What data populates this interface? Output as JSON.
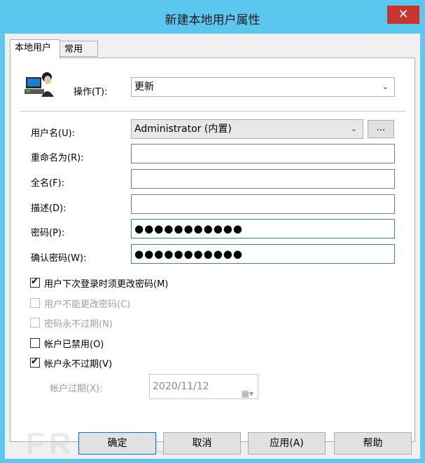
{
  "window": {
    "title": "新建本地用户属性",
    "close_label": "✕"
  },
  "tabs": [
    {
      "label": "本地用户",
      "active": true
    },
    {
      "label": "常用",
      "active": false
    }
  ],
  "icon": {
    "name": "user-computer-icon"
  },
  "operation": {
    "label": "操作(T):",
    "value": "更新"
  },
  "fields": {
    "username": {
      "label": "用户名(U):",
      "value": "Administrator (内置)",
      "browse_label": "..."
    },
    "rename": {
      "label": "重命名为(R):",
      "value": ""
    },
    "fullname": {
      "label": "全名(F):",
      "value": ""
    },
    "description": {
      "label": "描述(D):",
      "value": ""
    },
    "password": {
      "label": "密码(P):",
      "value": "●●●●●●●●●●●"
    },
    "confirm": {
      "label": "确认密码(W):",
      "value": "●●●●●●●●●●●"
    }
  },
  "checkboxes": [
    {
      "label": "用户下次登录时须更改密码(M)",
      "checked": true,
      "disabled": false
    },
    {
      "label": "用户不能更改密码(C)",
      "checked": false,
      "disabled": true
    },
    {
      "label": "密码永不过期(N)",
      "checked": false,
      "disabled": true
    },
    {
      "label": "帐户已禁用(O)",
      "checked": false,
      "disabled": false
    },
    {
      "label": "帐户永不过期(V)",
      "checked": true,
      "disabled": false
    }
  ],
  "expiry": {
    "label": "帐户过期(X):",
    "value": "2020/11/12"
  },
  "buttons": {
    "ok": "确定",
    "cancel": "取消",
    "apply": "应用(A)",
    "help": "帮助"
  },
  "watermark": "FREEBUF",
  "colors": {
    "titlebar": "#5cc7ee",
    "close": "#c7352c",
    "focus_border": "#3c7fb1"
  }
}
